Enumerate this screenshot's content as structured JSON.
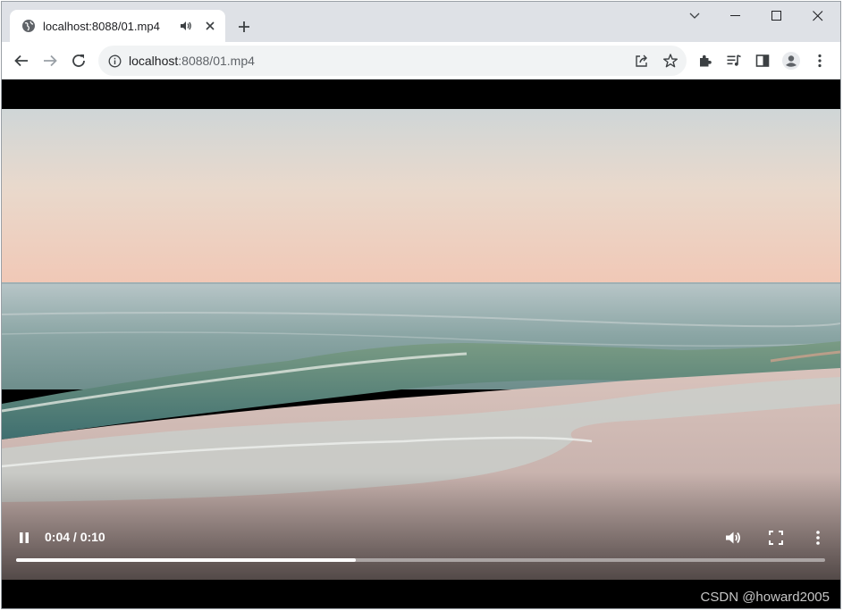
{
  "tab": {
    "title": "localhost:8088/01.mp4",
    "favicon": "globe-icon",
    "audio_indicator": "speaker-icon",
    "close_icon": "close-icon"
  },
  "window_controls": [
    "chevron-down-icon",
    "minimize-icon",
    "maximize-icon",
    "close-icon"
  ],
  "toolbar": {
    "back_icon": "arrow-left-icon",
    "forward_icon": "arrow-right-icon",
    "reload_icon": "reload-icon",
    "url_host": "localhost",
    "url_path": ":8088/01.mp4",
    "omnibox_icons": [
      "share-icon",
      "star-icon"
    ],
    "right_icons": [
      "extensions-icon",
      "media-queue-icon",
      "side-panel-icon",
      "profile-icon",
      "kebab-menu-icon"
    ]
  },
  "player": {
    "time_text": "0:04 / 0:10",
    "progress": 0.42,
    "play_state_icon": "pause-icon",
    "volume_icon": "volume-icon",
    "fullscreen_icon": "fullscreen-icon",
    "more_icon": "kebab-menu-icon"
  },
  "watermark": "CSDN @howard2005",
  "colors": {
    "tabstrip": "#dee1e6",
    "omnibox": "#f1f3f4",
    "video_background": "#000000"
  }
}
